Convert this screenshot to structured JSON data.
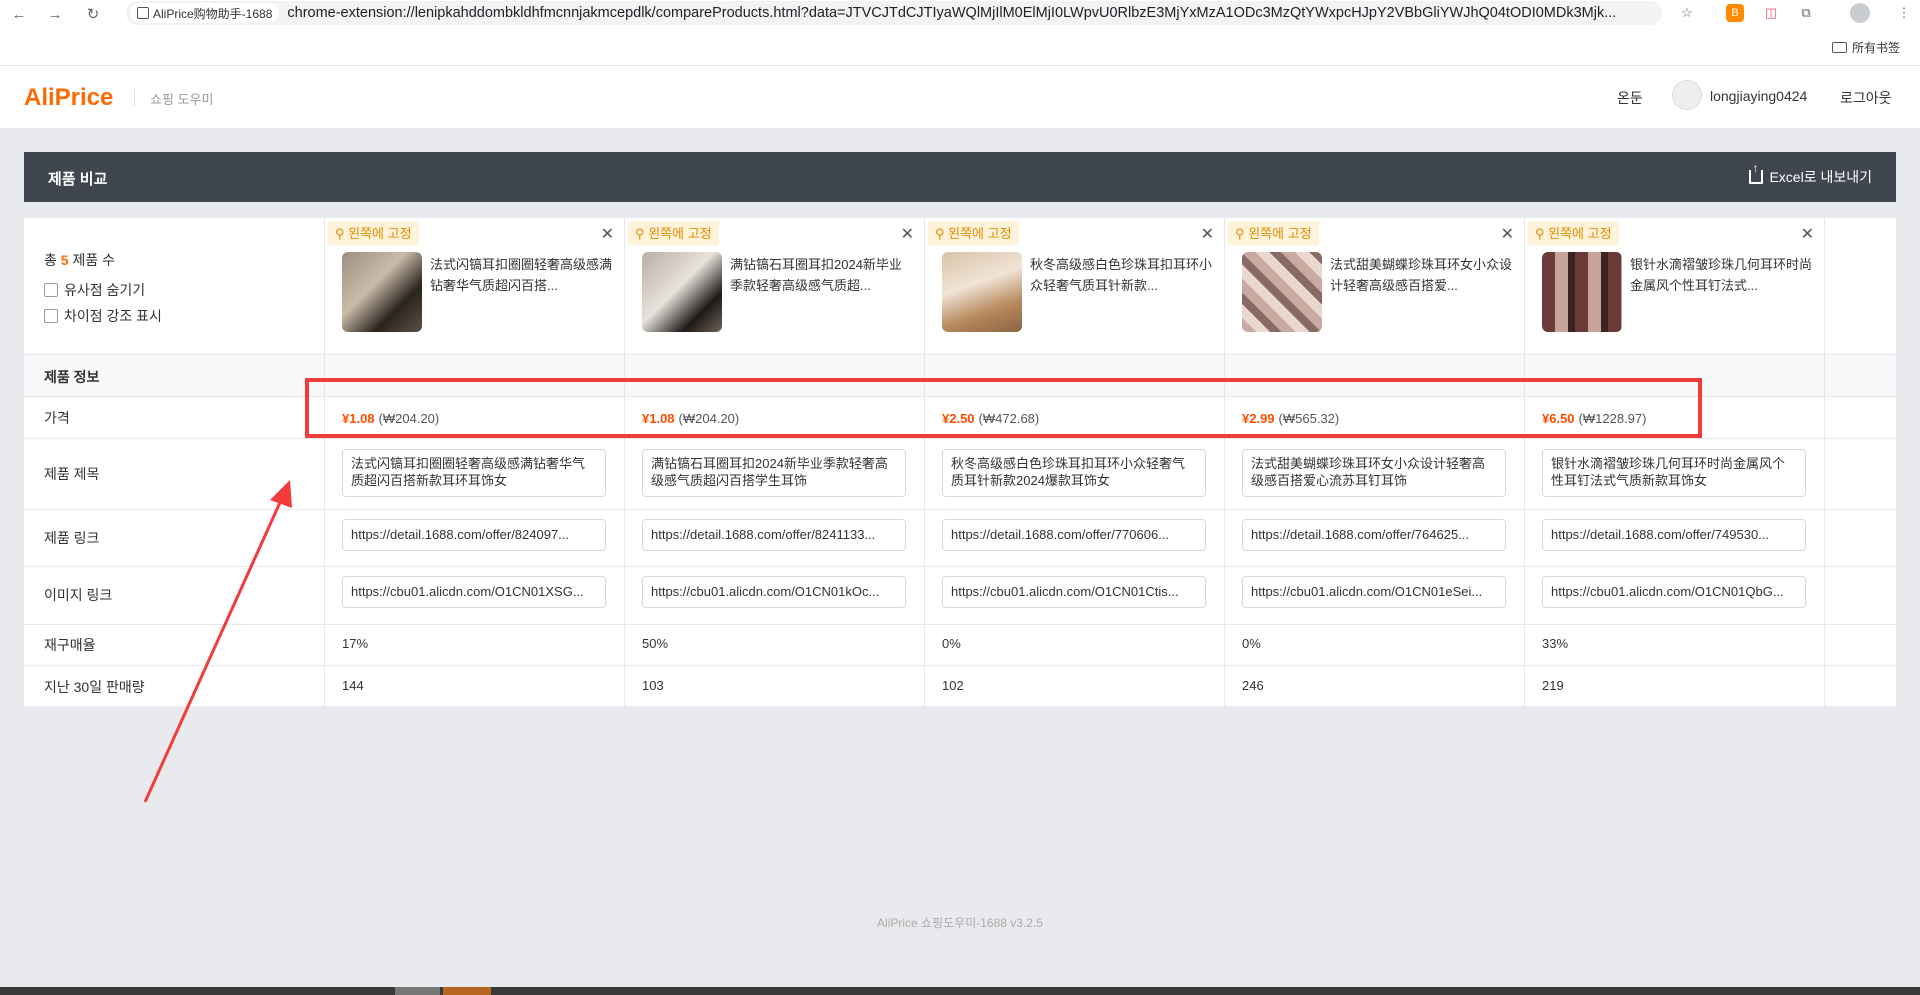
{
  "browser": {
    "tab_label": "AliPrice购物助手-1688",
    "url": "chrome-extension://lenipkahddombkldhfmcnnjakmcepdlk/compareProducts.html?data=JTVCJTdCJTIyaWQlMjIlM0ElMjI0LWpvU0RlbzE3MjYxMzA1ODc3MzQtYWxpcHJpY2VBbGliYWJhQ04tODI0MDk3Mjk...",
    "bookmarks_all": "所有书签"
  },
  "header": {
    "logo": "AliPrice",
    "subtitle": "쇼핑 도우미",
    "lang": "온둔",
    "username": "longjiaying0424",
    "logout": "로그아웃"
  },
  "titlebar": {
    "title": "제품 비교",
    "export_label": "Excel로 내보내기"
  },
  "summary": {
    "total_prefix": "총",
    "total_count": "5",
    "total_suffix": "제품 수",
    "hide_similar": "유사점 숨기기",
    "highlight_diff": "차이점 강조 표시"
  },
  "labels": {
    "section": "제품 정보",
    "price": "가격",
    "title": "제품 제목",
    "link": "제품 링크",
    "image": "이미지 링크",
    "repurchase": "재구매율",
    "sales": "지난 30일 판매량"
  },
  "pin_label": "왼쪽에 고정",
  "products": [
    {
      "title_short": "法式闪镐耳扣圈圈轻奢高级感满钻奢华气质超闪百搭...",
      "price": "¥1.08",
      "price_krw": "(₩204.20)",
      "title_full": "法式闪镐耳扣圈圈轻奢高级感满钻奢华气质超闪百搭新款耳环耳饰女",
      "link": "https://detail.1688.com/offer/824097...",
      "image_link": "https://cbu01.alicdn.com/O1CN01XSG...",
      "repurchase": "17%",
      "sales": "144"
    },
    {
      "title_short": "满钻镐石耳圈耳扣2024新毕业季款轻奢高级感气质超...",
      "price": "¥1.08",
      "price_krw": "(₩204.20)",
      "title_full": "满钻镐石耳圈耳扣2024新毕业季款轻奢高级感气质超闪百搭学生耳饰",
      "link": "https://detail.1688.com/offer/8241133...",
      "image_link": "https://cbu01.alicdn.com/O1CN01kOc...",
      "repurchase": "50%",
      "sales": "103"
    },
    {
      "title_short": "秋冬高级感白色珍珠耳扣耳环小众轻奢气质耳针新款...",
      "price": "¥2.50",
      "price_krw": "(₩472.68)",
      "title_full": "秋冬高级感白色珍珠耳扣耳环小众轻奢气质耳针新款2024爆款耳饰女",
      "link": "https://detail.1688.com/offer/770606...",
      "image_link": "https://cbu01.alicdn.com/O1CN01Ctis...",
      "repurchase": "0%",
      "sales": "102"
    },
    {
      "title_short": "法式甜美蝴蝶珍珠耳环女小众设计轻奢高级感百搭爱...",
      "price": "¥2.99",
      "price_krw": "(₩565.32)",
      "title_full": "法式甜美蝴蝶珍珠耳环女小众设计轻奢高级感百搭爱心流苏耳钉耳饰",
      "link": "https://detail.1688.com/offer/764625...",
      "image_link": "https://cbu01.alicdn.com/O1CN01eSei...",
      "repurchase": "0%",
      "sales": "246"
    },
    {
      "title_short": "银针水滴褶皱珍珠几何耳环时尚金属风个性耳钉法式...",
      "price": "¥6.50",
      "price_krw": "(₩1228.97)",
      "title_full": "银针水滴褶皱珍珠几何耳环时尚金属风个性耳钉法式气质新款耳饰女",
      "link": "https://detail.1688.com/offer/749530...",
      "image_link": "https://cbu01.alicdn.com/O1CN01QbG...",
      "repurchase": "33%",
      "sales": "219"
    }
  ],
  "footer": "AliPrice 쇼핑도우미-1688 v3.2.5",
  "colors": {
    "accent": "#ff6a00",
    "price": "#ff4d00",
    "annotation": "#f23c3c",
    "titlebar": "#3f4650"
  }
}
